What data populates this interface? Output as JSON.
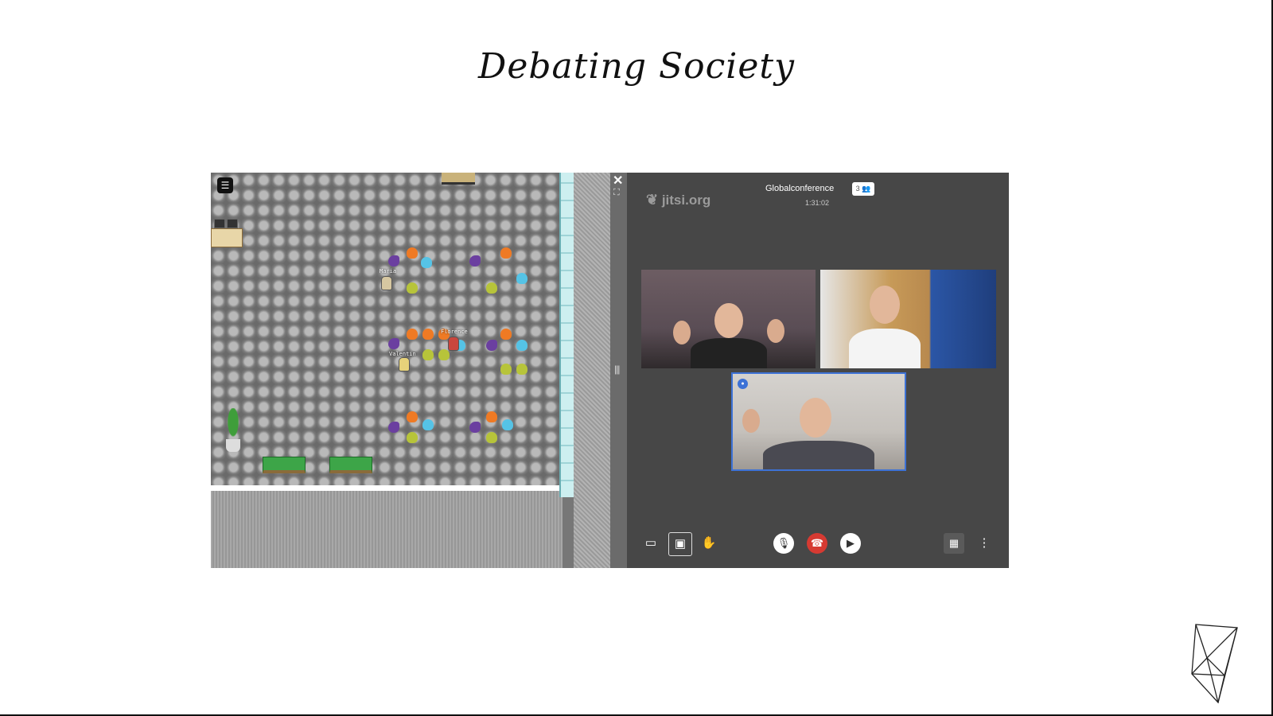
{
  "slide": {
    "title": "Debating Society"
  },
  "game": {
    "menu_icon": "menu-icon",
    "players": [
      {
        "name": "Maria"
      },
      {
        "name": "Florence"
      },
      {
        "name": "Valentin"
      }
    ],
    "close_label": "✕",
    "expand_label": "⛶",
    "handle_label": "|||"
  },
  "jitsi": {
    "logo": "jitsi.org",
    "conference_name": "Globalconference",
    "participant_count": "3",
    "elapsed_time": "1:31:02",
    "toolbar": {
      "chat_icon": "chat-icon",
      "share_icon": "screen-share-icon",
      "raise_hand_icon": "raise-hand-icon",
      "mic_icon": "microphone-icon",
      "hangup_icon": "hangup-icon",
      "camera_icon": "camera-icon",
      "tile_view_icon": "tile-view-icon",
      "more_icon": "more-icon"
    }
  },
  "colors": {
    "hangup": "#d63a32",
    "active_speaker": "#3d72d6",
    "jitsi_bg": "#474747"
  }
}
